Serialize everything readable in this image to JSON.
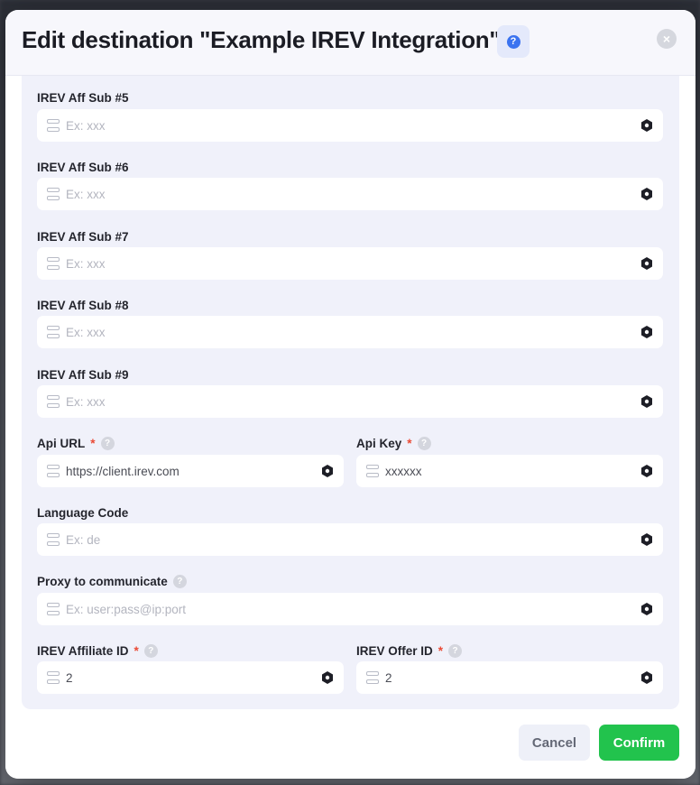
{
  "modal": {
    "title": "Edit destination \"Example IREV Integration\"",
    "help_glyph": "?",
    "close_glyph": "×"
  },
  "fields": {
    "aff_sub_5": {
      "label": "IREV Aff Sub #5",
      "placeholder": "Ex: xxx",
      "value": ""
    },
    "aff_sub_6": {
      "label": "IREV Aff Sub #6",
      "placeholder": "Ex: xxx",
      "value": ""
    },
    "aff_sub_7": {
      "label": "IREV Aff Sub #7",
      "placeholder": "Ex: xxx",
      "value": ""
    },
    "aff_sub_8": {
      "label": "IREV Aff Sub #8",
      "placeholder": "Ex: xxx",
      "value": ""
    },
    "aff_sub_9": {
      "label": "IREV Aff Sub #9",
      "placeholder": "Ex: xxx",
      "value": ""
    },
    "api_url": {
      "label": "Api URL",
      "required": "*",
      "value": "https://client.irev.com"
    },
    "api_key": {
      "label": "Api Key",
      "required": "*",
      "value": "xxxxxx"
    },
    "language_code": {
      "label": "Language Code",
      "placeholder": "Ex: de",
      "value": ""
    },
    "proxy": {
      "label": "Proxy to communicate",
      "placeholder": "Ex: user:pass@ip:port",
      "value": ""
    },
    "affiliate_id": {
      "label": "IREV Affiliate ID",
      "required": "*",
      "value": "2"
    },
    "offer_id": {
      "label": "IREV Offer ID",
      "required": "*",
      "value": "2"
    }
  },
  "footer": {
    "cancel_label": "Cancel",
    "confirm_label": "Confirm"
  },
  "colors": {
    "accent": "#22c34d",
    "help_blue": "#3b73f0",
    "required": "#ea4a35"
  },
  "icons": {
    "field_prefix": "server-stack-icon",
    "field_suffix": "hexagon-dot-icon",
    "tooltip": "question-circle-icon"
  }
}
